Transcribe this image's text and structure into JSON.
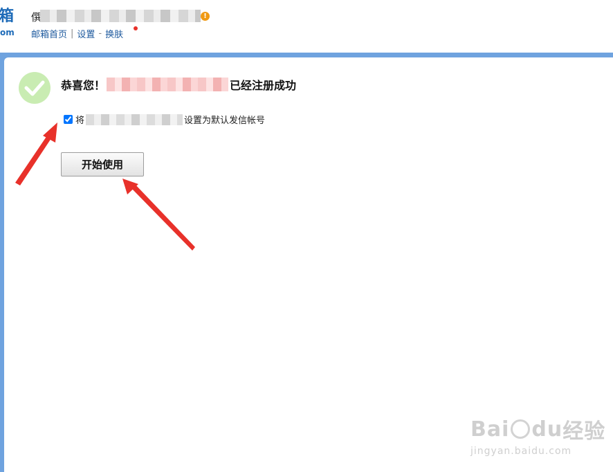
{
  "header": {
    "logo_text": "箱",
    "logo_sub": "om",
    "account_prefix": "僎",
    "warning_badge": "!",
    "links": {
      "home": "邮箱首页",
      "sep1": "|",
      "settings": "设置",
      "sep2": "-",
      "skin": "换肤"
    }
  },
  "main": {
    "title_prefix": "恭喜您！",
    "title_suffix": "已经注册成功",
    "default_checkbox_checked": true,
    "default_prefix": "将",
    "default_suffix": "设置为默认发信帐号",
    "start_button": "开始使用"
  },
  "watermark": {
    "brand": "Bai",
    "brand2": "du",
    "brand_cn": "经验",
    "url": "jingyan.baidu.com"
  },
  "colors": {
    "frame_blue": "#6fa3df",
    "link_blue": "#1e5a9e",
    "success_green": "#c9ecb2",
    "arrow_red": "#e8312a"
  },
  "icons": {
    "success": "check-circle-icon",
    "warning": "warning-icon"
  }
}
